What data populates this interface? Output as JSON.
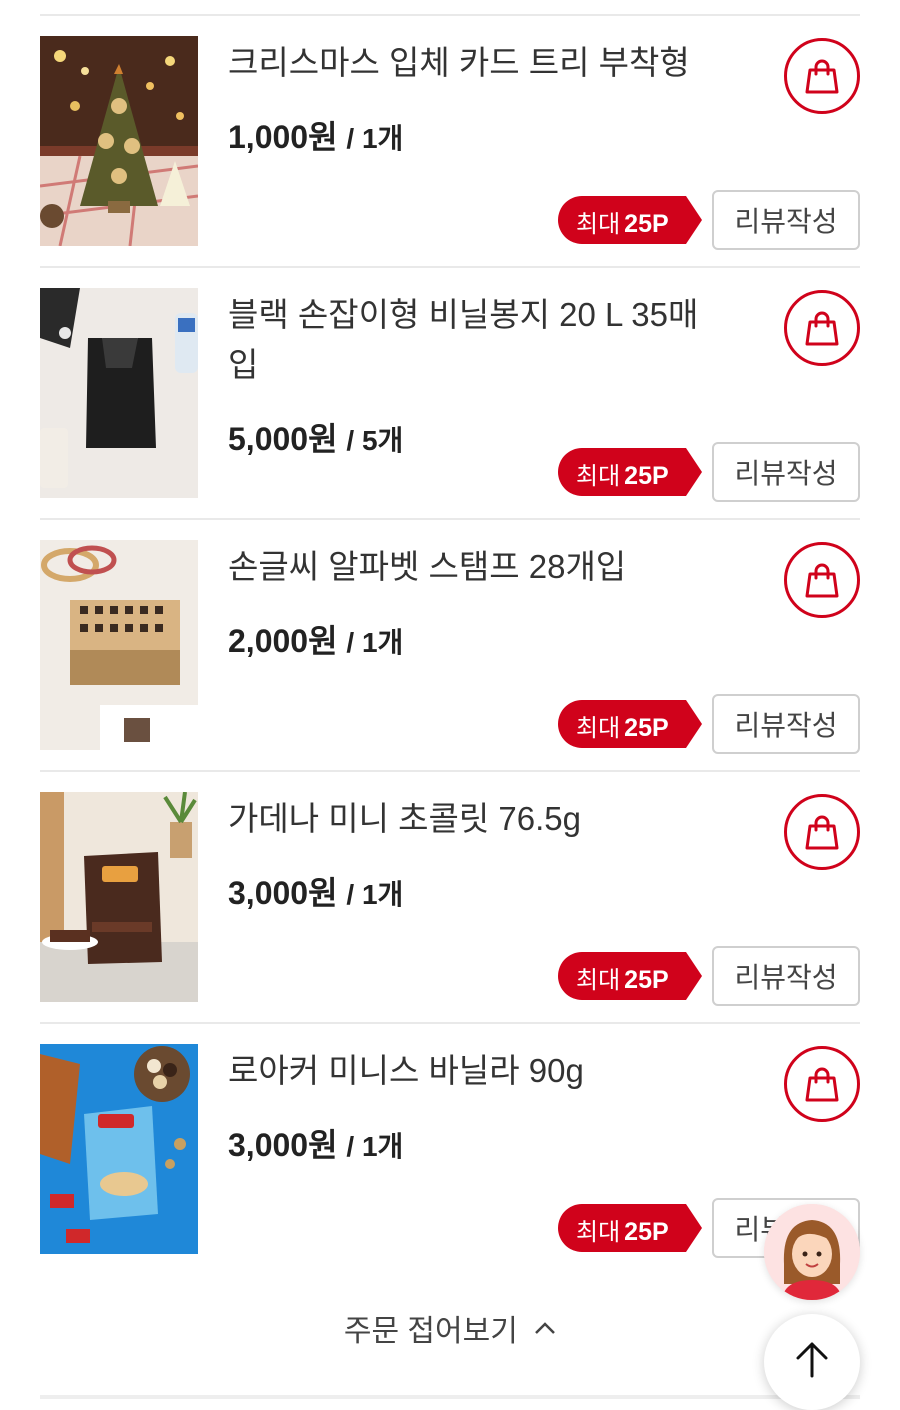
{
  "items": [
    {
      "name": "크리스마스 입체 카드 트리 부착형",
      "price": "1,000원",
      "qty": "/ 1개",
      "badge_prefix": "최대",
      "badge_points": "25P",
      "review_label": "리뷰작성"
    },
    {
      "name": "블랙 손잡이형 비닐봉지 20 L 35매입",
      "price": "5,000원",
      "qty": "/ 5개",
      "badge_prefix": "최대",
      "badge_points": "25P",
      "review_label": "리뷰작성"
    },
    {
      "name": "손글씨 알파벳 스탬프 28개입",
      "price": "2,000원",
      "qty": "/ 1개",
      "badge_prefix": "최대",
      "badge_points": "25P",
      "review_label": "리뷰작성"
    },
    {
      "name": "가데나 미니 초콜릿 76.5g",
      "price": "3,000원",
      "qty": "/ 1개",
      "badge_prefix": "최대",
      "badge_points": "25P",
      "review_label": "리뷰작성"
    },
    {
      "name": "로아커 미니스 바닐라 90g",
      "price": "3,000원",
      "qty": "/ 1개",
      "badge_prefix": "최대",
      "badge_points": "25P",
      "review_label": "리뷰작성"
    }
  ],
  "collapse_label": "주문 접어보기",
  "icons": {
    "cart": "shopping-bag-icon",
    "collapse": "chevron-up-icon",
    "top": "arrow-up-icon"
  },
  "colors": {
    "accent": "#d0021b",
    "divider": "#e9e9e9"
  }
}
